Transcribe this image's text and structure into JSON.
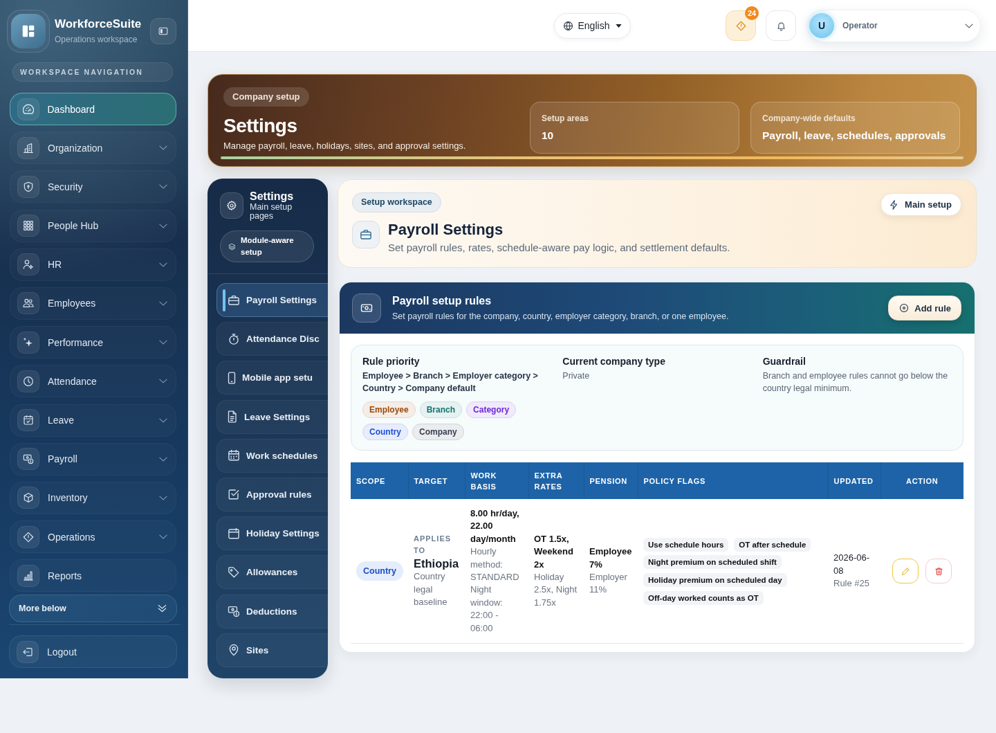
{
  "sidebar": {
    "brand": {
      "name": "WorkforceSuite",
      "subtitle": "Operations workspace"
    },
    "section_label": "WORKSPACE NAVIGATION",
    "items": [
      {
        "label": "Dashboard",
        "selected": true,
        "expandable": false
      },
      {
        "label": "Organization",
        "selected": false,
        "expandable": true
      },
      {
        "label": "Security",
        "selected": false,
        "expandable": true
      },
      {
        "label": "People Hub",
        "selected": false,
        "expandable": true
      },
      {
        "label": "HR",
        "selected": false,
        "expandable": true
      },
      {
        "label": "Employees",
        "selected": false,
        "expandable": true
      },
      {
        "label": "Performance",
        "selected": false,
        "expandable": true
      },
      {
        "label": "Attendance",
        "selected": false,
        "expandable": true
      },
      {
        "label": "Leave",
        "selected": false,
        "expandable": true
      },
      {
        "label": "Payroll",
        "selected": false,
        "expandable": true
      },
      {
        "label": "Inventory",
        "selected": false,
        "expandable": true
      },
      {
        "label": "Operations",
        "selected": false,
        "expandable": true
      },
      {
        "label": "Reports",
        "selected": false,
        "expandable": false
      }
    ],
    "more_button": "More below",
    "logout_button": "Logout"
  },
  "top_bar": {
    "language": "English",
    "alerts_count": "24",
    "user": {
      "initial": "U",
      "name": "Operator"
    }
  },
  "banner": {
    "eyebrow": "Company setup",
    "title": "Settings",
    "subtitle": "Manage payroll, leave, holidays, sites, and approval settings.",
    "stats": [
      {
        "label": "Setup areas",
        "value": "10"
      },
      {
        "label": "Company-wide defaults",
        "value": "Payroll, leave, schedules, approvals"
      }
    ]
  },
  "settings_nav": {
    "title": "Settings",
    "subtitle": "Main setup pages",
    "module_label": "Module-aware setup",
    "items": [
      {
        "label": "Payroll Settings",
        "selected": true
      },
      {
        "label": "Attendance Disc",
        "selected": false
      },
      {
        "label": "Mobile app setu",
        "selected": false
      },
      {
        "label": "Leave Settings",
        "selected": false
      },
      {
        "label": "Work schedules",
        "selected": false
      },
      {
        "label": "Approval rules",
        "selected": false
      },
      {
        "label": "Holiday Settings",
        "selected": false
      },
      {
        "label": "Allowances",
        "selected": false
      },
      {
        "label": "Deductions",
        "selected": false
      },
      {
        "label": "Sites",
        "selected": false
      }
    ]
  },
  "page_header": {
    "eyebrow": "Setup workspace",
    "title": "Payroll Settings",
    "subtitle": "Set payroll rules, rates, schedule-aware pay logic, and settlement defaults.",
    "main_setup_button": "Main setup"
  },
  "rules_panel": {
    "title": "Payroll setup rules",
    "subtitle": "Set payroll rules for the company, country, employer category, branch, or one employee.",
    "add_button": "Add rule",
    "rule_priority": {
      "heading": "Rule priority",
      "text": "Employee > Branch > Employer category > Country > Company default",
      "chips": [
        {
          "label": "Employee",
          "color": "#9a4a0c"
        },
        {
          "label": "Branch",
          "color": "#0f766e"
        },
        {
          "label": "Category",
          "color": "#6d28d9"
        },
        {
          "label": "Country",
          "color": "#1d4ed8"
        },
        {
          "label": "Company",
          "color": "#374151"
        }
      ]
    },
    "company_type": {
      "heading": "Current company type",
      "value": "Private"
    },
    "guardrail": {
      "heading": "Guardrail",
      "text": "Branch and employee rules cannot go below the country legal minimum."
    },
    "table": {
      "columns": [
        "SCOPE",
        "TARGET",
        "WORK BASIS",
        "EXTRA RATES",
        "PENSION",
        "POLICY FLAGS",
        "UPDATED",
        "ACTION"
      ],
      "rows": [
        {
          "scope": "Country",
          "target": {
            "label": "APPLIES TO",
            "name": "Ethiopia",
            "note": "Country legal baseline"
          },
          "work_basis": {
            "main": "8.00 hr/day, 22.00 day/month",
            "details": [
              "Hourly method: STANDARD",
              "Night window: 22:00 - 06:00"
            ]
          },
          "extra_rates": {
            "main": "OT 1.5x, Weekend 2x",
            "detail": "Holiday 2.5x, Night 1.75x"
          },
          "pension": {
            "main": "Employee 7%",
            "detail": "Employer 11%"
          },
          "policy_flags": [
            "Use schedule hours",
            "OT after schedule",
            "Night premium on scheduled shift",
            "Holiday premium on scheduled day",
            "Off-day worked counts as OT"
          ],
          "updated": {
            "date": "2026-06-08",
            "note": "Rule #25"
          }
        }
      ]
    }
  }
}
